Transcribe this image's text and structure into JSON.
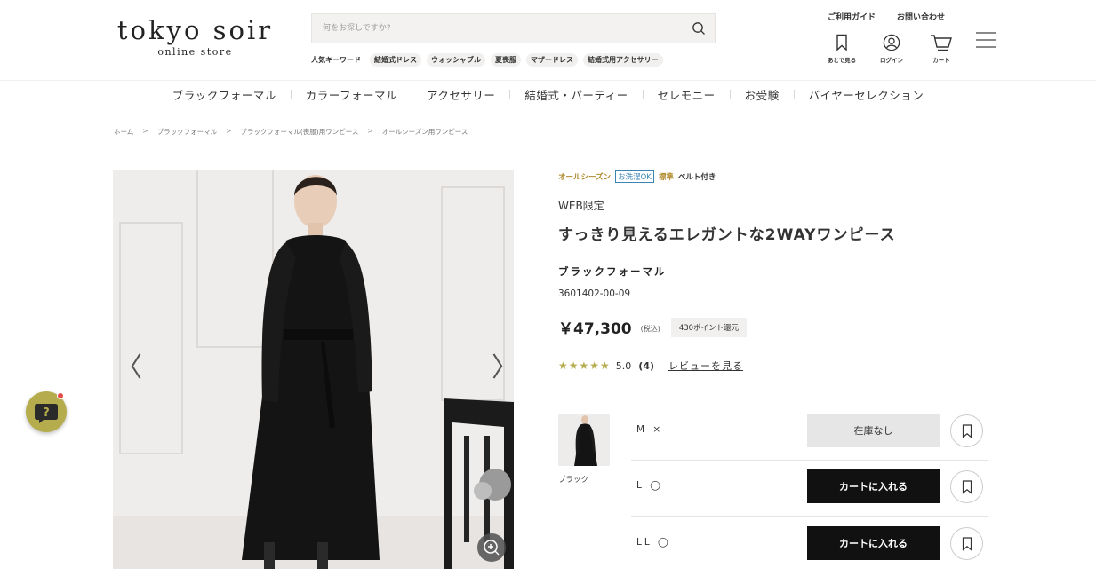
{
  "header": {
    "logo_main": "tokyo soir",
    "logo_sub": "online store",
    "search_placeholder": "何をお探しですか?",
    "keywords_label": "人気キーワード",
    "keywords": [
      "結婚式ドレス",
      "ウォッシャブル",
      "夏喪服",
      "マザードレス",
      "結婚式用アクセサリー"
    ],
    "links": {
      "guide": "ご利用ガイド",
      "contact": "お問い合わせ"
    },
    "icons": {
      "watchlist": "あとで見る",
      "login": "ログイン",
      "cart": "カート"
    }
  },
  "nav": [
    "ブラックフォーマル",
    "カラーフォーマル",
    "アクセサリー",
    "結婚式・パーティー",
    "セレモニー",
    "お受験",
    "バイヤーセレクション"
  ],
  "breadcrumb": [
    "ホーム",
    "ブラックフォーマル",
    "ブラックフォーマル(喪服)用ワンピース",
    "オールシーズン用ワンピース"
  ],
  "product": {
    "tags": {
      "season": "オールシーズン",
      "washable": "お洗濯OK",
      "standard": "標準",
      "belt": "ベルト付き"
    },
    "web_limited": "WEB限定",
    "title": "すっきり見えるエレガントな2WAYワンピース",
    "category": "ブラックフォーマル",
    "sku": "3601402-00-09",
    "price": "￥47,300",
    "tax_note": "(税込)",
    "points": "430ポイント還元",
    "rating": {
      "stars": 5,
      "score": "5.0",
      "count": "(4)",
      "review_link": "レビューを見る"
    },
    "color_label": "ブラック",
    "sizes": [
      {
        "label": "M ×",
        "button": "在庫なし",
        "status": "soldout"
      },
      {
        "label": "L ◯",
        "button": "カートに入れる",
        "status": "available"
      },
      {
        "label": "LL ◯",
        "button": "カートに入れる",
        "status": "available"
      }
    ]
  },
  "gallery": {
    "prev": "〈",
    "next": "〉"
  },
  "colors": {
    "accent_gold": "#b5ad4d",
    "tag_season": "#b08a2e",
    "tag_wash": "#3c86b5",
    "button_black": "#111111",
    "help_dot": "#e8474a"
  }
}
